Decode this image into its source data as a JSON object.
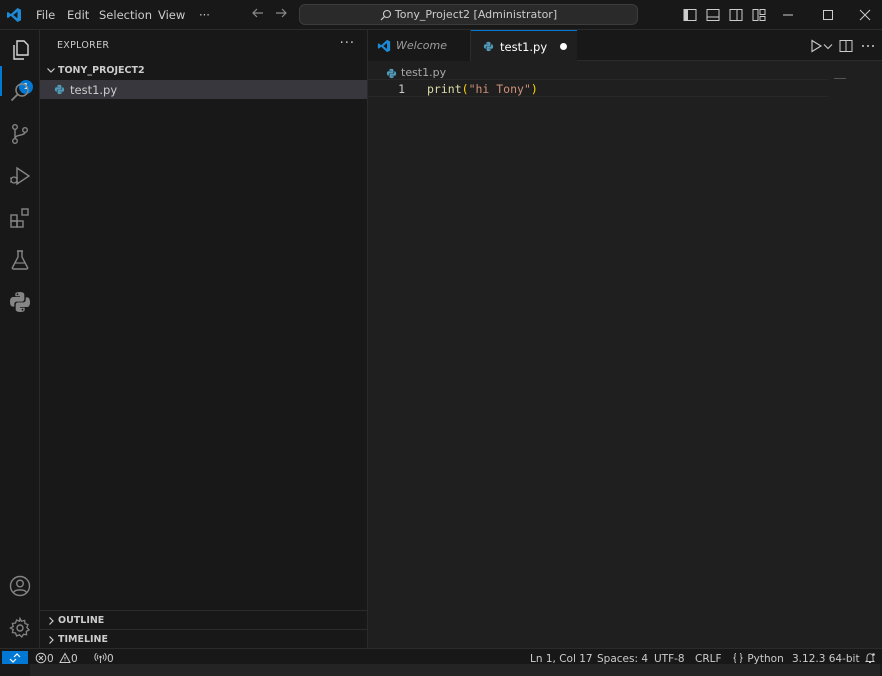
{
  "titlebar": {
    "menu": [
      "File",
      "Edit",
      "Selection",
      "View"
    ],
    "more": "···",
    "command_center": "Tony_Project2 [Administrator]"
  },
  "activity_bar": {
    "items": [
      "explorer",
      "search",
      "source-control",
      "run-and-debug",
      "extensions",
      "testing",
      "python"
    ],
    "explorer_badge": "1",
    "bottom": [
      "accounts",
      "manage"
    ]
  },
  "sidebar": {
    "title": "EXPLORER",
    "more": "···",
    "folder": "TONY_PROJECT2",
    "files": [
      "test1.py"
    ],
    "panels": [
      "OUTLINE",
      "TIMELINE"
    ]
  },
  "editor": {
    "tabs": [
      {
        "label": "Welcome",
        "active": false
      },
      {
        "label": "test1.py",
        "active": true,
        "dirty": true
      }
    ],
    "breadcrumb": "test1.py",
    "lines": [
      {
        "number": "1",
        "tokens": {
          "fn": "print",
          "open": "(",
          "string": "\"hi Tony\"",
          "close": ")"
        }
      }
    ]
  },
  "statusbar": {
    "errors": "0",
    "warnings": "0",
    "ports": "0",
    "position": "Ln 1, Col 17",
    "spaces": "Spaces: 4",
    "encoding": "UTF-8",
    "eol": "CRLF",
    "language": "Python",
    "interpreter": "3.12.3 64-bit"
  },
  "colors": {
    "accent": "#0078d4",
    "background": "#1f1f1f",
    "sidebar": "#181818",
    "selection": "#37373d"
  }
}
